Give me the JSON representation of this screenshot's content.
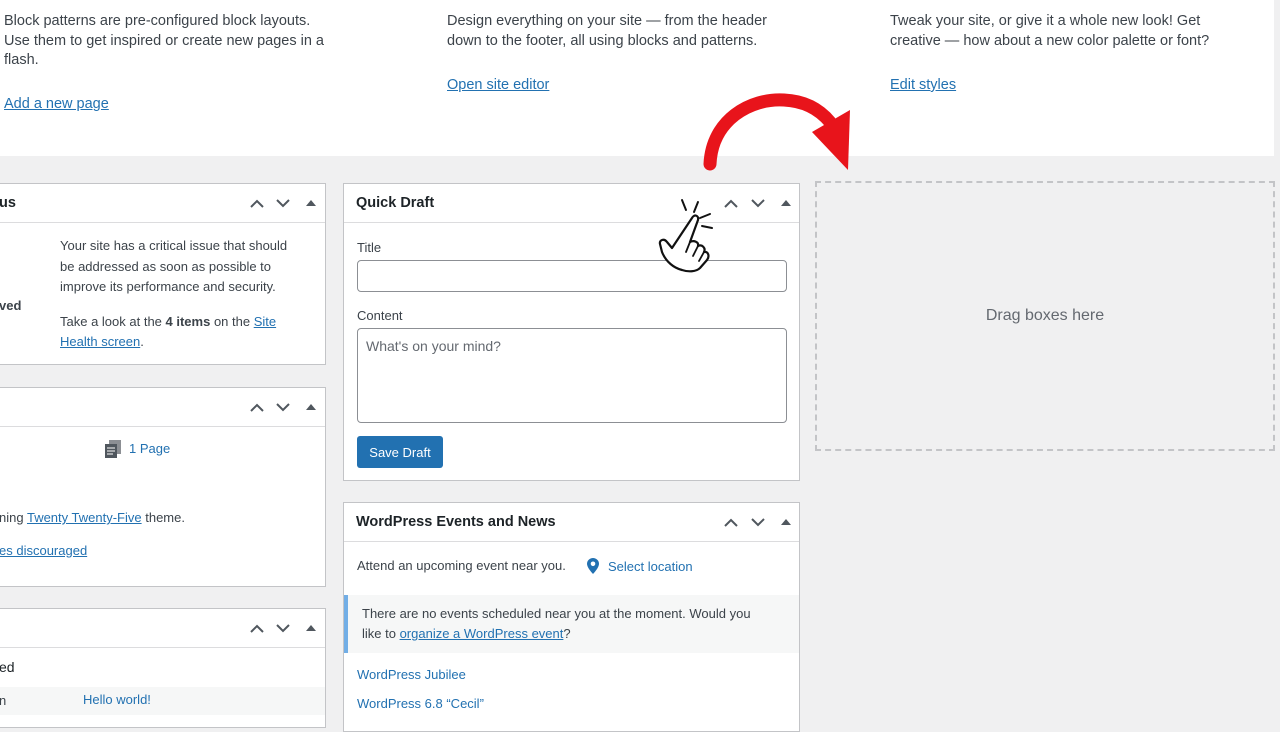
{
  "welcome": {
    "col1": {
      "text": "Block patterns are pre-configured block layouts. Use them to get inspired or create new pages in a flash.",
      "link": "Add a new page"
    },
    "col2": {
      "text": "Design everything on your site — from the header down to the footer, all using blocks and patterns.",
      "link": "Open site editor"
    },
    "col3": {
      "text": "Tweak your site, or give it a whole new look! Get creative — how about a new color palette or font?",
      "link": "Edit styles"
    }
  },
  "site_health": {
    "title_fragment": "us",
    "side_fragment": "ved",
    "message": [
      "Your site has a critical issue that should",
      "be addressed as soon as possible to",
      "improve its performance and security."
    ],
    "look_prefix": "Take a look at the ",
    "items_count": "4 items",
    "look_mid": " on the ",
    "link_part1": "Site",
    "link_part2": "Health screen",
    "period": "."
  },
  "at_a_glance": {
    "pages": "1 Page",
    "running_prefix": "ning ",
    "theme_link": "Twenty Twenty-Five",
    "running_suffix": " theme.",
    "discouraged": "es discouraged"
  },
  "activity": {
    "fragment": "ed",
    "row_fragment": "n",
    "post_link": "Hello world!"
  },
  "quick_draft": {
    "title": "Quick Draft",
    "title_label": "Title",
    "title_value": "",
    "content_label": "Content",
    "content_placeholder": "What's on your mind?",
    "save_label": "Save Draft"
  },
  "events": {
    "title": "WordPress Events and News",
    "attend_text": "Attend an upcoming event near you.",
    "select_location": "Select location",
    "notice_line1": "There are no events scheduled near you at the moment. Would you",
    "notice_prefix": "like to ",
    "notice_link": "organize a WordPress event",
    "notice_suffix": "?",
    "news": [
      "WordPress Jubilee",
      "WordPress 6.8 “Cecil”"
    ]
  },
  "drop_zone": {
    "label": "Drag boxes here"
  },
  "colors": {
    "accent": "#2271b1",
    "overlay_red": "#e8141b",
    "background": "#f0f0f1"
  },
  "icons": {
    "move_up": "chevron-up-icon",
    "move_down": "chevron-down-icon",
    "toggle": "caret-up-icon",
    "pages": "document-icon",
    "location": "location-pin-icon",
    "pointer": "hand-pointer-icon",
    "arrow": "curved-arrow-icon"
  }
}
